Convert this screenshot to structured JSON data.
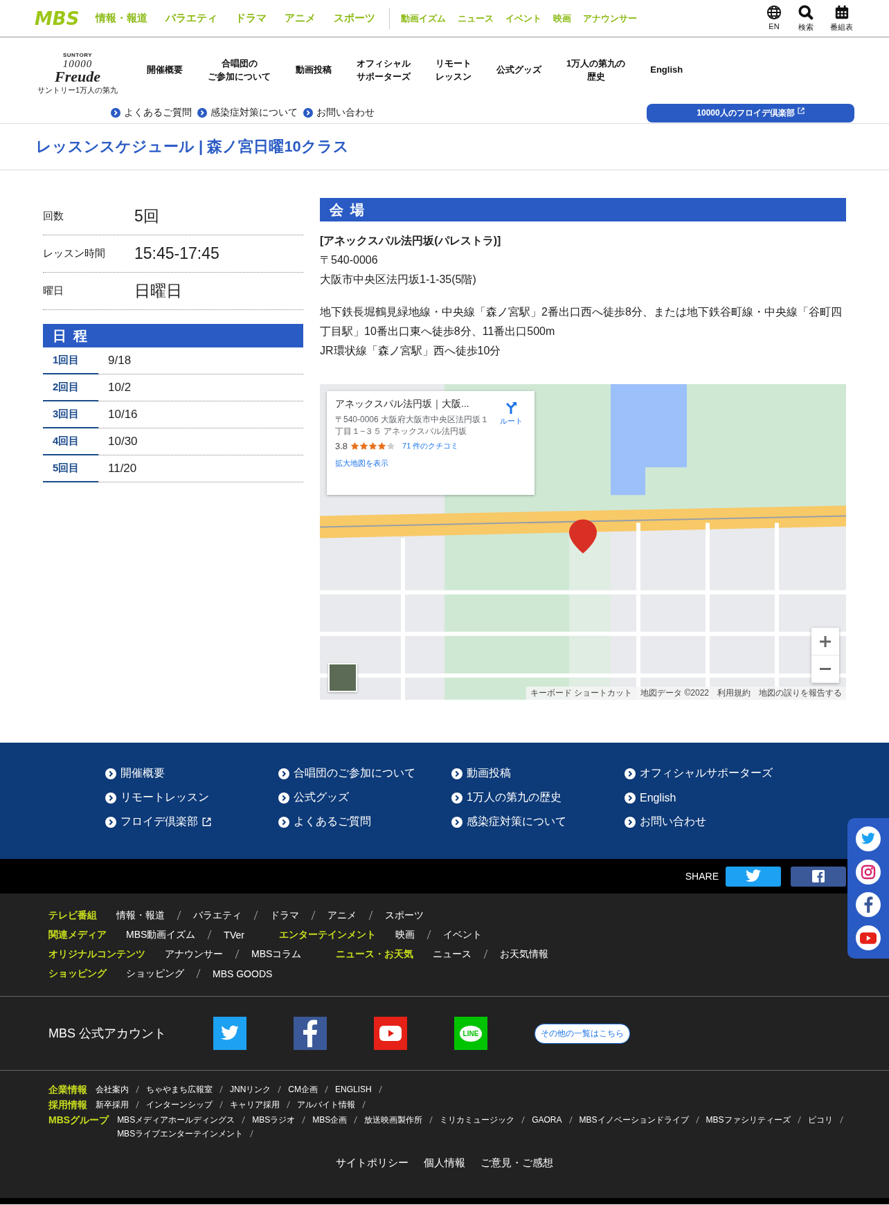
{
  "global_header": {
    "logo": "MBS",
    "nav_primary": [
      "情報・報道",
      "バラエティ",
      "ドラマ",
      "アニメ",
      "スポーツ"
    ],
    "nav_secondary": [
      "動画イズム",
      "ニュース",
      "イベント",
      "映画",
      "アナウンサー"
    ],
    "utilities": [
      {
        "kind": "globe",
        "label": "EN"
      },
      {
        "kind": "search",
        "label": "検索"
      },
      {
        "kind": "calendar",
        "label": "番組表"
      }
    ]
  },
  "site_header": {
    "logo": {
      "brand": "SUNTORY",
      "number": "10000",
      "name": "Freude",
      "caption": "サントリー1万人の第九"
    },
    "nav": [
      {
        "lines": [
          "開催概要"
        ]
      },
      {
        "lines": [
          "合唱団の",
          "ご参加について"
        ]
      },
      {
        "lines": [
          "動画投稿"
        ]
      },
      {
        "lines": [
          "オフィシャル",
          "サポーターズ"
        ]
      },
      {
        "lines": [
          "リモート",
          "レッスン"
        ]
      },
      {
        "lines": [
          "公式グッズ"
        ]
      },
      {
        "lines": [
          "1万人の第九の",
          "歴史"
        ]
      },
      {
        "lines": [
          "English"
        ]
      }
    ],
    "sub_links": [
      "よくあるご質問",
      "感染症対策について",
      "お問い合わせ"
    ],
    "club_button": "10000人のフロイデ倶楽部"
  },
  "page_title": "レッスンスケジュール | 森ノ宮日曜10クラス",
  "summary": [
    {
      "label": "回数",
      "value": "5回"
    },
    {
      "label": "レッスン時間",
      "value": "15:45-17:45"
    },
    {
      "label": "曜日",
      "value": "日曜日"
    }
  ],
  "schedule": {
    "heading": "日 程",
    "rows": [
      {
        "label": "1回目",
        "date": "9/18"
      },
      {
        "label": "2回目",
        "date": "10/2"
      },
      {
        "label": "3回目",
        "date": "10/16"
      },
      {
        "label": "4回目",
        "date": "10/30"
      },
      {
        "label": "5回目",
        "date": "11/20"
      }
    ]
  },
  "venue": {
    "heading": "会 場",
    "name": "[アネックスパル法円坂(パレストラ)]",
    "postal": "〒540-0006",
    "address": "大阪市中央区法円坂1-1-35(5階)",
    "access": [
      "地下鉄長堀鶴見緑地線・中央線「森ノ宮駅」2番出口西へ徒歩8分、または地下鉄谷町線・中央線「谷町四丁目駅」10番出口東へ徒歩8分、11番出口500m",
      "JR環状線「森ノ宮駅」西へ徒歩10分"
    ]
  },
  "map": {
    "card": {
      "title": "アネックスパル法円坂｜大阪...",
      "address": "〒540-0006 大阪府大阪市中央区法円坂１丁目１−３５ アネックスパル法円坂",
      "rating": "3.8",
      "stars": 4,
      "reviews": "71 件のクチコミ",
      "route": "ルート",
      "larger_map": "拡大地図を表示"
    },
    "attribution": [
      "キーボード ショートカット",
      "地図データ ©2022",
      "利用規約",
      "地図の誤りを報告する"
    ]
  },
  "footer_links": [
    {
      "label": "開催概要",
      "external": false
    },
    {
      "label": "合唱団のご参加について",
      "external": false
    },
    {
      "label": "動画投稿",
      "external": false
    },
    {
      "label": "オフィシャルサポーターズ",
      "external": false
    },
    {
      "label": "リモートレッスン",
      "external": false
    },
    {
      "label": "公式グッズ",
      "external": false
    },
    {
      "label": "1万人の第九の歴史",
      "external": false
    },
    {
      "label": "English",
      "external": false
    },
    {
      "label": "フロイデ倶楽部",
      "external": true
    },
    {
      "label": "よくあるご質問",
      "external": false
    },
    {
      "label": "感染症対策について",
      "external": false
    },
    {
      "label": "お問い合わせ",
      "external": false
    }
  ],
  "share": {
    "label": "SHARE",
    "buttons": [
      {
        "kind": "twitter"
      },
      {
        "kind": "facebook"
      }
    ]
  },
  "footer_categories": [
    [
      {
        "heading": "テレビ番組",
        "links": [
          "情報・報道",
          "バラエティ",
          "ドラマ",
          "アニメ",
          "スポーツ"
        ]
      }
    ],
    [
      {
        "heading": "関連メディア",
        "links": [
          "MBS動画イズム",
          "TVer"
        ]
      },
      {
        "heading": "エンターテインメント",
        "links": [
          "映画",
          "イベント"
        ]
      }
    ],
    [
      {
        "heading": "オリジナルコンテンツ",
        "links": [
          "アナウンサー",
          "MBSコラム"
        ]
      },
      {
        "heading": "ニュース・お天気",
        "links": [
          "ニュース",
          "お天気情報"
        ]
      }
    ],
    [
      {
        "heading": "ショッピング",
        "links": [
          "ショッピング",
          "MBS GOODS"
        ]
      }
    ]
  ],
  "official_accounts": {
    "label": "MBS 公式アカウント",
    "accounts": [
      {
        "kind": "twitter"
      },
      {
        "kind": "facebook"
      },
      {
        "kind": "youtube"
      },
      {
        "kind": "line",
        "label": "LINE"
      }
    ],
    "more": "その他の一覧はこちら"
  },
  "corporate": [
    {
      "heading": "企業情報",
      "links": [
        "会社案内",
        "ちゃやまち広報室",
        "JNNリンク",
        "CM企画",
        "ENGLISH"
      ]
    },
    {
      "heading": "採用情報",
      "links": [
        "新卒採用",
        "インターンシップ",
        "キャリア採用",
        "アルバイト情報"
      ]
    },
    {
      "heading": "MBSグループ",
      "links": [
        "MBSメディアホールディングス",
        "MBSラジオ",
        "MBS企画",
        "放送映画製作所",
        "ミリカミュージック",
        "GAORA",
        "MBSイノベーションドライブ",
        "MBSファシリティーズ",
        "ピコリ",
        "MBSライブエンターテインメント"
      ]
    }
  ],
  "bottom_links": [
    "サイトポリシー",
    "個人情報",
    "ご意見・ご感想"
  ],
  "floating_share": [
    {
      "kind": "twitter"
    },
    {
      "kind": "instagram"
    },
    {
      "kind": "facebook"
    },
    {
      "kind": "youtube"
    }
  ]
}
